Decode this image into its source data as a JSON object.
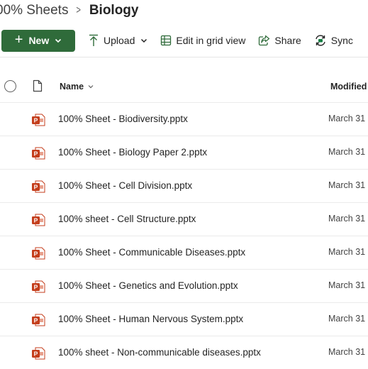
{
  "breadcrumb": {
    "parent": "00% Sheets",
    "separator": ">",
    "current": "Biology"
  },
  "toolbar": {
    "new_label": "New",
    "upload_label": "Upload",
    "edit_grid_label": "Edit in grid view",
    "share_label": "Share",
    "sync_label": "Sync"
  },
  "columns": {
    "name": "Name",
    "modified": "Modified"
  },
  "files": [
    {
      "name": "100% Sheet - Biodiversity.pptx",
      "modified": "March 31",
      "type": "pptx-icon"
    },
    {
      "name": "100% Sheet - Biology Paper 2.pptx",
      "modified": "March 31",
      "type": "pptx-icon"
    },
    {
      "name": "100% Sheet - Cell Division.pptx",
      "modified": "March 31",
      "type": "pptx-icon"
    },
    {
      "name": "100% sheet - Cell Structure.pptx",
      "modified": "March 31",
      "type": "pptx-icon"
    },
    {
      "name": "100% Sheet - Communicable Diseases.pptx",
      "modified": "March 31",
      "type": "pptx-icon"
    },
    {
      "name": "100% Sheet - Genetics and Evolution.pptx",
      "modified": "March 31",
      "type": "pptx-icon"
    },
    {
      "name": "100% Sheet - Human Nervous System.pptx",
      "modified": "March 31",
      "type": "pptx-icon"
    },
    {
      "name": "100% sheet - Non-communicable diseases.pptx",
      "modified": "March 31",
      "type": "pptx-icon"
    }
  ],
  "colors": {
    "new_button": "#2f6b3a",
    "pptx": "#c43e1c",
    "sync_accent": "#107c41"
  }
}
